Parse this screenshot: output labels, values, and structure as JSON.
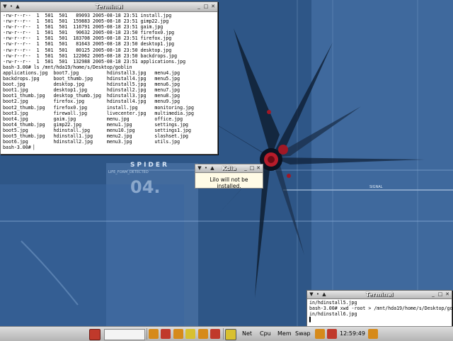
{
  "wallpaper": {
    "brand": "SPIDER",
    "code": "LIFE_FORM_DETECTED",
    "number": "04.",
    "tag": "SIGNAL"
  },
  "terminal_main": {
    "title": "Terminal",
    "lines": [
      "-rw-r--r--  1  501  501   89093 2005-08-18 23:51 install.jpg",
      "-rw-r--r--  1  501  501  159883 2005-08-18 23:51 gimp22.jpg",
      "-rw-r--r--  1  501  501  116791 2005-08-18 23:51 gaim.jpg",
      "-rw-r--r--  1  501  501   90632 2005-08-18 23:50 firefox0.jpg",
      "-rw-r--r--  1  501  501  183708 2005-08-18 23:51 firefox.jpg",
      "-rw-r--r--  1  501  501   81643 2005-08-18 23:50 desktop1.jpg",
      "-rw-r--r--  1  501  501   80125 2005-08-18 23:50 desktop.jpg",
      "-rw-r--r--  1  501  501  122062 2005-08-18 23:50 backdrops.jpg",
      "-rw-r--r--  1  501  501  132988 2005-08-18 23:51 applications.jpg",
      "bash-3.00# ls /mnt/hda19/home/s/Desktop/goblin",
      "applications.jpg  boot7.jpg          hdinstall3.jpg   menu4.jpg",
      "backdrops.jpg     boot_thumb.jpg     hdinstall4.jpg   menu5.jpg",
      "boot.jpg          desktop.jpg        hdinstall5.jpg   menu6.jpg",
      "boot1.jpg         desktop1.jpg       hdinstall2.jpg   menu7.jpg",
      "boot1_thumb.jpg   desktop_thumb.jpg  hdinstall3.jpg   menu8.jpg",
      "boot2.jpg         firefox.jpg        hdinstall4.jpg   menu9.jpg",
      "boot2_thumb.jpg   firefox0.jpg       install.jpg      monitoring.jpg",
      "boot3.jpg         firewall.jpg       livecenter.jpg   multimedia.jpg",
      "boot4.jpg         gaim.jpg           menu.jpg         office.jpg",
      "boot4_thumb.jpg   gimp22.jpg         menu1.jpg        settings.jpg",
      "boot5.jpg         hdinstall.jpg      menu10.jpg       settings1.jpg",
      "boot5_thumb.jpg   hdinstall1.jpg     menu2.jpg        slashset.jpg",
      "boot6.jpg         hdinstall2.jpg     menu3.jpg        utils.jpg",
      "bash-3.00# ▏"
    ]
  },
  "popup": {
    "title": "Kdia",
    "message": "Lilo will not be installed."
  },
  "terminal_small": {
    "title": "Terminal",
    "lines": [
      "in/hdinstall5.jpg",
      "bash-3.00# xwd -root > /mnt/hda19/home/s/Desktop/gobl",
      "in/hdinstall6.jpg",
      "▌"
    ]
  },
  "taskbar": {
    "monitors": [
      "Net",
      "Cpu",
      "Mem",
      "Swap"
    ],
    "clock": "12:59:49",
    "colors": {
      "red": "#c0392b",
      "orange": "#d68a1a",
      "yellow": "#d8c030"
    }
  }
}
